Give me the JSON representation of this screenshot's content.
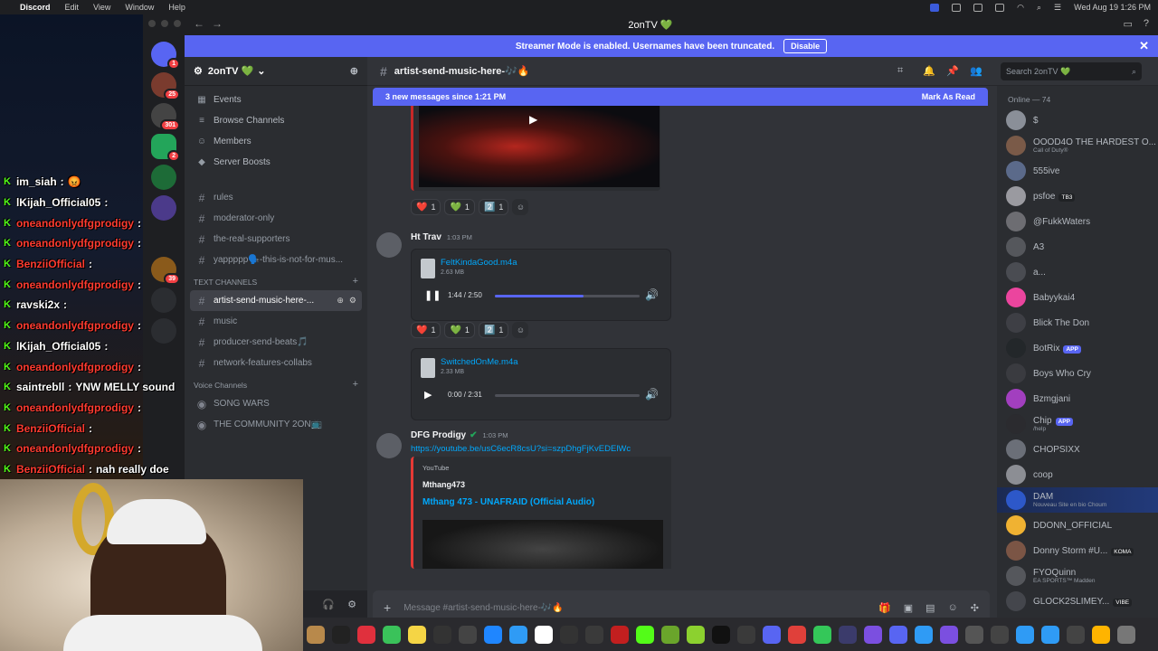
{
  "menubar": {
    "app": "Discord",
    "items": [
      "Edit",
      "View",
      "Window",
      "Help"
    ],
    "clock": "Wed Aug 19  1:26 PM"
  },
  "window": {
    "title": "2onTV 💚"
  },
  "streamer_bar": {
    "text": "Streamer Mode is enabled. Usernames have been truncated.",
    "button": "Disable"
  },
  "server_rail": {
    "badges": [
      "1",
      "25",
      "301",
      "2",
      "39"
    ]
  },
  "sidebar": {
    "server_name": "2onTV 💚",
    "menu": [
      {
        "icon": "calendar-icon",
        "label": "Events"
      },
      {
        "icon": "browse-icon",
        "label": "Browse Channels"
      },
      {
        "icon": "members-icon",
        "label": "Members"
      },
      {
        "icon": "boost-icon",
        "label": "Server Boosts"
      }
    ],
    "channels": [
      {
        "label": "rules",
        "selected": false
      },
      {
        "label": "moderator-only",
        "selected": false
      },
      {
        "label": "the-real-supporters",
        "selected": false
      },
      {
        "label": "yappppp🗣️-this-is-not-for-mus...",
        "selected": false
      },
      {
        "label": "artist-send-music-here-...",
        "selected": true
      },
      {
        "label": "music",
        "selected": false
      },
      {
        "label": "producer-send-beats🎵",
        "selected": false
      },
      {
        "label": "network-features-collabs",
        "selected": false
      }
    ],
    "categories": {
      "text": "TEXT CHANNELS",
      "voice": "Voice Channels"
    },
    "voice_channels": [
      {
        "label": "SONG WARS"
      },
      {
        "label": "THE COMMUNITY 2ON📺"
      }
    ]
  },
  "channel": {
    "name": "artist-send-music-here-🎶🔥",
    "new_messages": "3 new messages since 1:21 PM",
    "mark_read": "Mark As Read",
    "composer_placeholder": "Message #artist-send-music-here-🎶🔥"
  },
  "reactions": [
    {
      "emoji": "❤️",
      "count": "1"
    },
    {
      "emoji": "💚",
      "count": "1"
    },
    {
      "emoji": "2️⃣",
      "count": "1"
    }
  ],
  "messages": [
    {
      "author": "Ht Trav",
      "time": "1:03 PM",
      "attachments": [
        {
          "name": "FeltKindaGood.m4a",
          "size": "2.63 MB",
          "time": "1:44 / 2:50",
          "progress": 0.61,
          "playing": true
        },
        {
          "name": "SwitchedOnMe.m4a",
          "size": "2.33 MB",
          "time": "0:00 / 2:31",
          "progress": 0.0,
          "playing": false
        }
      ]
    },
    {
      "author": "DFG Prodigy",
      "time": "1:03 PM",
      "link": "https://youtube.be/usC6ecR8csU?si=szpDhgFjKvEDElWc",
      "embed": {
        "provider": "YouTube",
        "author": "Mthang473",
        "title": "Mthang 473 - UNAFRAID (Official Audio)"
      }
    }
  ],
  "members": {
    "search_placeholder": "Search 2onTV 💚",
    "online_label": "Online — 74",
    "list": [
      {
        "name": "$",
        "sub": "",
        "tag": ""
      },
      {
        "name": "ΟΟΟD4Ο THE HARDEST O...",
        "sub": "Call of Duty®",
        "tag": ""
      },
      {
        "name": "555ive",
        "sub": "",
        "tag": ""
      },
      {
        "name": "psfoe",
        "sub": "",
        "tag": "TB3"
      },
      {
        "name": "@FukkWaters",
        "sub": "",
        "tag": ""
      },
      {
        "name": "A3",
        "sub": "",
        "tag": ""
      },
      {
        "name": "a...",
        "sub": "",
        "tag": ""
      },
      {
        "name": "Babyykai4",
        "sub": "",
        "tag": ""
      },
      {
        "name": "Blick The Don",
        "sub": "",
        "tag": ""
      },
      {
        "name": "BotRix",
        "sub": "",
        "tag": "APP"
      },
      {
        "name": "Boys Who Cry",
        "sub": "",
        "tag": ""
      },
      {
        "name": "Bzmgjani",
        "sub": "",
        "tag": ""
      },
      {
        "name": "Chip",
        "sub": "/help",
        "tag": "APP"
      },
      {
        "name": "CHOPSIXX",
        "sub": "",
        "tag": ""
      },
      {
        "name": "coop",
        "sub": "",
        "tag": ""
      },
      {
        "name": "DAM",
        "sub": "Nouveau Site en bio Choum",
        "tag": ""
      },
      {
        "name": "DDONN_OFFICIAL",
        "sub": "",
        "tag": ""
      },
      {
        "name": "Donny Storm #U...",
        "sub": "",
        "tag": "KOMA"
      },
      {
        "name": "FYOQuinn",
        "sub": "EA SPORTS™ Madden",
        "tag": ""
      },
      {
        "name": "GLOCK2SLIMEY...",
        "sub": "",
        "tag": "VIBE"
      }
    ]
  },
  "overlay_chat": [
    {
      "user": "im_siah",
      "color": "#ffffff",
      "msg": "😡"
    },
    {
      "user": "lKijah_Official05",
      "color": "#ffffff",
      "msg": ""
    },
    {
      "user": "oneandonlydfgprodigy",
      "color": "#ff3b30",
      "msg": ""
    },
    {
      "user": "oneandonlydfgprodigy",
      "color": "#ff3b30",
      "msg": ""
    },
    {
      "user": "BenziiOfficial",
      "color": "#ff3b30",
      "msg": ""
    },
    {
      "user": "oneandonlydfgprodigy",
      "color": "#ff3b30",
      "msg": ""
    },
    {
      "user": "ravski2x",
      "color": "#ffffff",
      "msg": ""
    },
    {
      "user": "oneandonlydfgprodigy",
      "color": "#ff3b30",
      "msg": ""
    },
    {
      "user": "lKijah_Official05",
      "color": "#ffffff",
      "msg": ""
    },
    {
      "user": "oneandonlydfgprodigy",
      "color": "#ff3b30",
      "msg": ""
    },
    {
      "user": "saintrebll",
      "color": "#ffffff",
      "msg": "YNW MELLY sound"
    },
    {
      "user": "oneandonlydfgprodigy",
      "color": "#ff3b30",
      "msg": ""
    },
    {
      "user": "BenziiOfficial",
      "color": "#ff3b30",
      "msg": ""
    },
    {
      "user": "oneandonlydfgprodigy",
      "color": "#ff3b30",
      "msg": ""
    },
    {
      "user": "BenziiOfficial",
      "color": "#ff3b30",
      "msg": "nah really doe"
    }
  ],
  "colors": {
    "accent": "#5865f2",
    "kick_green": "#53fc18",
    "link": "#00a8fc"
  }
}
